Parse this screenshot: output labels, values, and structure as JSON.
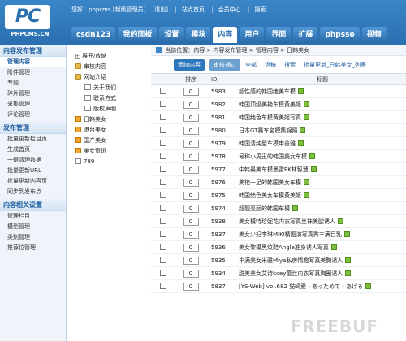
{
  "logo": {
    "text": "PC",
    "subtitle": "PHPCMS.CN"
  },
  "topbar": {
    "greeting": "您好！phpcms [超级管理员]",
    "logout": "[退出]",
    "site_home": "站点首页",
    "member_center": "会员中心",
    "search": "搜索"
  },
  "tabs": [
    "csdn123",
    "我的面板",
    "设置",
    "模块",
    "内容",
    "用户",
    "界面",
    "扩展",
    "phpsso",
    "视频"
  ],
  "active_tab": 4,
  "leftnav": {
    "groups": [
      {
        "title": "内容发布管理",
        "items": [
          "管理内容",
          "附件管理",
          "专题",
          "碎片管理",
          "采集管理",
          "评论管理"
        ]
      },
      {
        "title": "发布管理",
        "items": [
          "批量更新栏目页",
          "生成首页",
          "一键清理数据",
          "批量更新URL",
          "批量更新内容页",
          "同步到发布点"
        ]
      },
      {
        "title": "内容相关设置",
        "items": [
          "管理栏目",
          "模型管理",
          "类别管理",
          "推荐位管理"
        ]
      }
    ]
  },
  "tree": {
    "nodes": [
      {
        "label": "展开/收缩",
        "indent": 0,
        "icon": "plus"
      },
      {
        "label": "审核内容",
        "indent": 0,
        "icon": "folder"
      },
      {
        "label": "网站介绍",
        "indent": 0,
        "icon": "folder"
      },
      {
        "label": "关于我们",
        "indent": 1,
        "icon": "page"
      },
      {
        "label": "联系方式",
        "indent": 1,
        "icon": "page"
      },
      {
        "label": "版权声明",
        "indent": 1,
        "icon": "page"
      },
      {
        "label": "日韩美女",
        "indent": 0,
        "icon": "orange"
      },
      {
        "label": "港台美女",
        "indent": 0,
        "icon": "orange"
      },
      {
        "label": "国产美女",
        "indent": 0,
        "icon": "orange"
      },
      {
        "label": "美女资讯",
        "indent": 0,
        "icon": "orange"
      },
      {
        "label": "789",
        "indent": 0,
        "icon": "page"
      }
    ]
  },
  "breadcrumb": "当前位置：内容 > 内容发布管理 > 管理内容 > 日韩美女",
  "toolbar": {
    "add": "添加内容",
    "review": "审核通过",
    "all": "全部",
    "recycle": "退稿",
    "search": "搜索",
    "batch": "批量更新_日韩美女_列表"
  },
  "table": {
    "headers": {
      "order": "排序",
      "id": "ID",
      "title": "标题"
    },
    "rows": [
      {
        "order": "0",
        "id": "5983",
        "title": "超性感的韩国绝美车模"
      },
      {
        "order": "0",
        "id": "5982",
        "title": "韩国顶级美艳车模黄美姬"
      },
      {
        "order": "0",
        "id": "5981",
        "title": "韩国绝色车模黄美姬写真"
      },
      {
        "order": "0",
        "id": "5980",
        "title": "日本GT赛车名模集锦照"
      },
      {
        "order": "0",
        "id": "5979",
        "title": "韩国清纯型车模申善雅"
      },
      {
        "order": "0",
        "id": "5978",
        "title": "号称小周迅的韩国美女车模"
      },
      {
        "order": "0",
        "id": "5977",
        "title": "中韩最美车模墨雷PK林智慧"
      },
      {
        "order": "0",
        "id": "5976",
        "title": "美艳十足的韩国美女车模"
      },
      {
        "order": "0",
        "id": "5975",
        "title": "韩国绝色美女车模黄美姬"
      },
      {
        "order": "0",
        "id": "5974",
        "title": "超靓亮丽的韩国车模"
      },
      {
        "order": "0",
        "id": "5938",
        "title": "美女模特珍妮花内衣写真丝袜美腿诱人"
      },
      {
        "order": "0",
        "id": "5937",
        "title": "美女少妇李琳MIKI精图演写真秀丰满巨乳"
      },
      {
        "order": "0",
        "id": "5936",
        "title": "美女黎模黑纹鞋Angle准身诱人写真"
      },
      {
        "order": "0",
        "id": "5935",
        "title": "丰满美女米雅Miya私房情趣写真美胸诱人"
      },
      {
        "order": "0",
        "id": "5934",
        "title": "甜美美女艾诗kcey蕾丝内衣写真胸圈诱人"
      },
      {
        "order": "0",
        "id": "5837",
        "title": "[YS-Web] vol.682 猫崎爱・あっためて・あげる"
      }
    ]
  },
  "watermark": "FREEBUF"
}
